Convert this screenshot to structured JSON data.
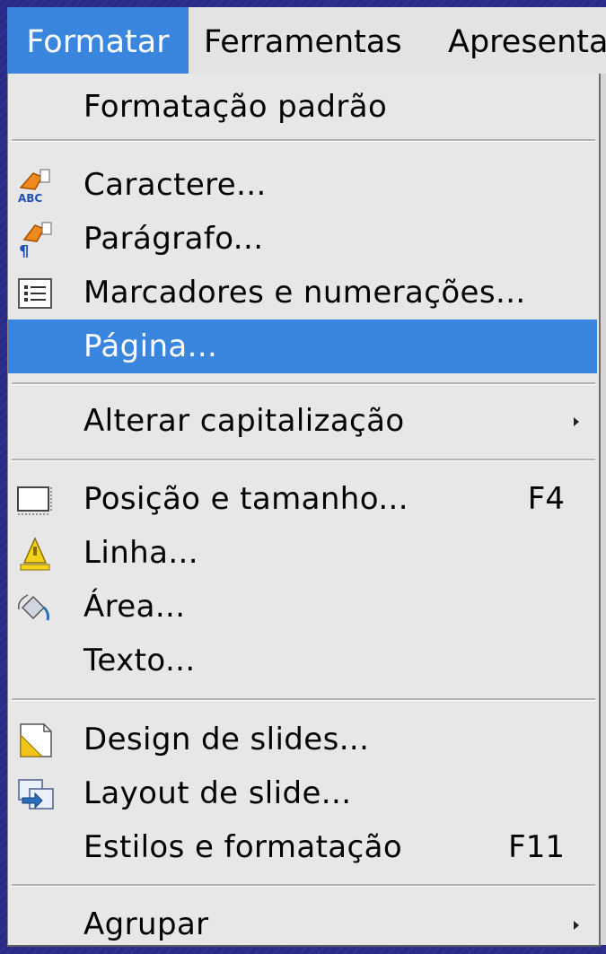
{
  "menubar": {
    "items": [
      {
        "label": "Formatar"
      },
      {
        "label": "Ferramentas"
      },
      {
        "label": "Apresenta"
      }
    ]
  },
  "menu": {
    "items": [
      {
        "label": "Formatação padrão"
      },
      {
        "label": "Caractere..."
      },
      {
        "label": "Parágrafo..."
      },
      {
        "label": "Marcadores e numerações..."
      },
      {
        "label": "Página..."
      },
      {
        "label": "Alterar capitalização"
      },
      {
        "label": "Posição e tamanho...",
        "shortcut": "F4"
      },
      {
        "label": "Linha..."
      },
      {
        "label": "Área..."
      },
      {
        "label": "Texto..."
      },
      {
        "label": "Design de slides..."
      },
      {
        "label": "Layout de slide..."
      },
      {
        "label": "Estilos e formatação",
        "shortcut": "F11"
      },
      {
        "label": "Agrupar"
      }
    ],
    "highlighted": "Página...",
    "accent_color": "#3a86df"
  },
  "icons": {
    "caractere": "character-format-icon",
    "paragrafo": "paragraph-format-icon",
    "marcadores": "bullets-numbering-icon",
    "posicao": "position-size-icon",
    "linha": "line-icon",
    "area": "area-fill-icon",
    "design": "slide-design-icon",
    "layout": "slide-layout-icon"
  }
}
